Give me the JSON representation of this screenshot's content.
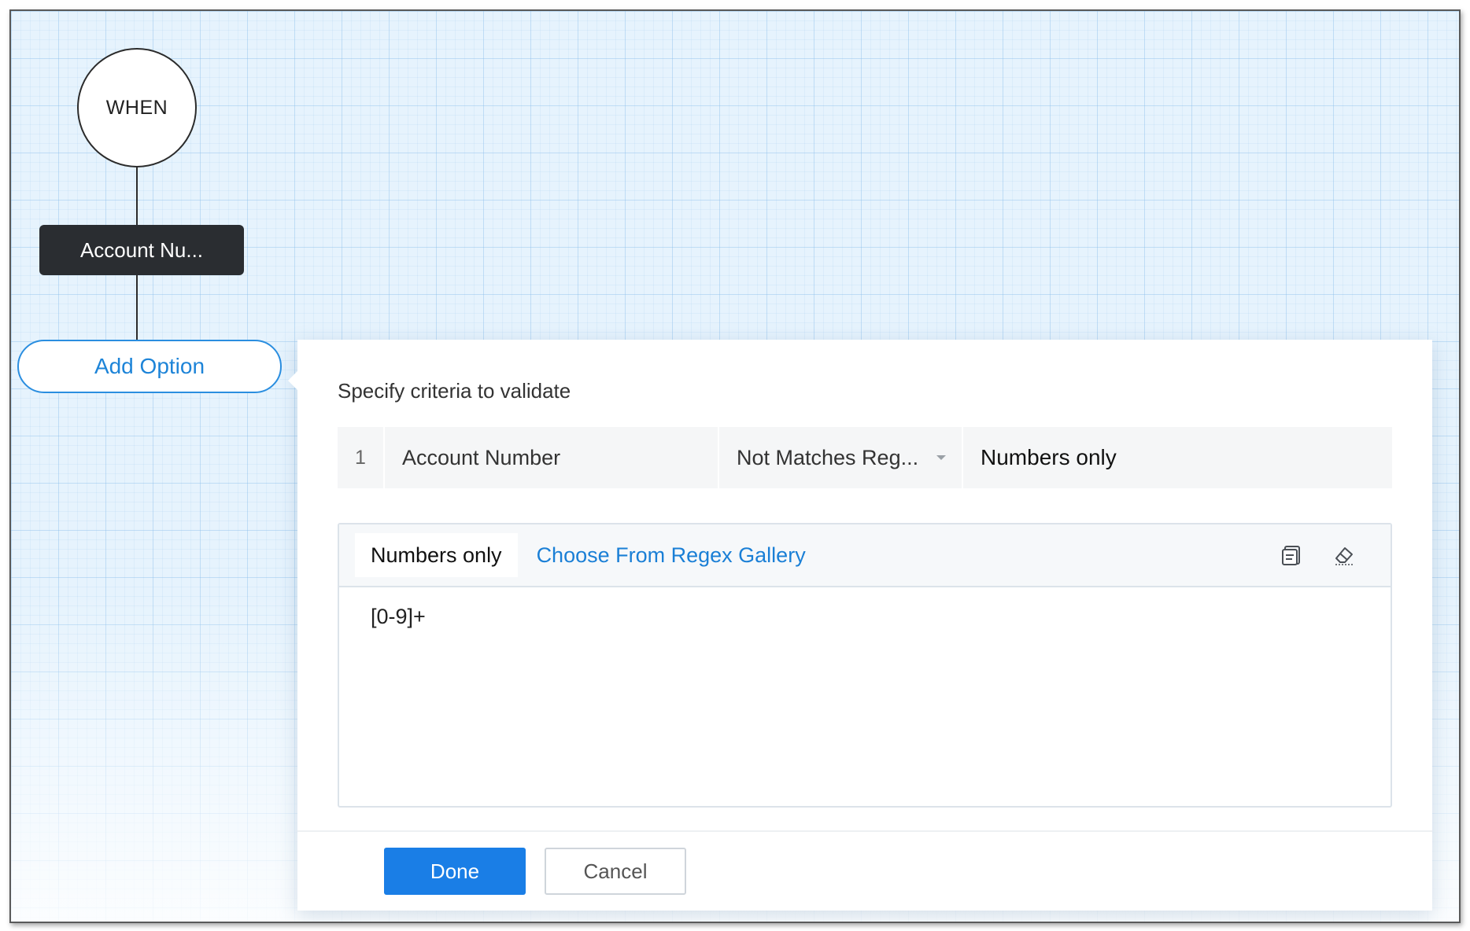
{
  "flow": {
    "when_label": "WHEN",
    "field_node_label": "Account Nu...",
    "add_option_label": "Add Option"
  },
  "panel": {
    "title": "Specify criteria to validate",
    "criteria": {
      "index": "1",
      "field": "Account Number",
      "operator": "Not Matches Reg...",
      "value": "Numbers only"
    },
    "regex": {
      "tab_label": "Numbers only",
      "gallery_link": "Choose From Regex Gallery",
      "expression": "[0-9]+",
      "tools": [
        "copy-icon",
        "eraser-icon"
      ]
    },
    "buttons": {
      "done": "Done",
      "cancel": "Cancel"
    }
  },
  "colors": {
    "accent": "#1a7ee6",
    "node_dark": "#2a2d31",
    "canvas": "#e6f3fd"
  }
}
